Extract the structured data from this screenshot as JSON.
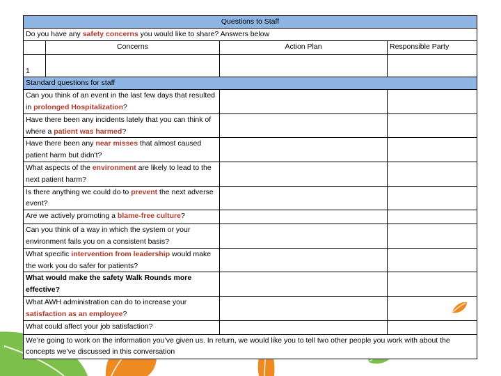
{
  "colors": {
    "header_blue": "#8DB4E2",
    "highlight_red": "#B0392C",
    "leaf_green": "#7CBF4B",
    "leaf_orange": "#ED8B22",
    "border": "#000000",
    "text": "#000000"
  },
  "table": {
    "title": "Questions to Staff",
    "prompt_prefix": "Do you have any ",
    "prompt_highlight": "safety concerns",
    "prompt_suffix": " you would like to share?  Answers below",
    "columns": {
      "number": "",
      "concerns": "Concerns",
      "action_plan": "Action Plan",
      "responsible_party": "Responsible Party"
    },
    "entry_row": {
      "number": "1",
      "concerns": "",
      "action_plan": "",
      "responsible_party": ""
    },
    "section_header": "Standard questions for staff",
    "questions": [
      {
        "id": "q-prolonged-hospitalization",
        "pre": "Can you think of an event in the last few days that resulted in ",
        "highlight": "prolonged Hospitalization",
        "highlight_style": "red",
        "post": "?",
        "lines": 2
      },
      {
        "id": "q-patient-was-harmed",
        "pre": "Have there been any incidents lately that you can think of where a ",
        "highlight": "patient was harmed",
        "highlight_style": "red",
        "post": "?",
        "lines": 2
      },
      {
        "id": "q-near-misses",
        "pre": "Have there been any ",
        "highlight": "near misses",
        "highlight_style": "red",
        "post": " that almost caused patient harm but didn't?",
        "lines": 2
      },
      {
        "id": "q-environment",
        "pre": "What aspects of the ",
        "highlight": "environment",
        "highlight_style": "red",
        "post": " are likely to lead to the next patient harm?",
        "lines": 2
      },
      {
        "id": "q-prevent",
        "pre": "Is there anything we could do to ",
        "highlight": "prevent",
        "highlight_style": "red",
        "post": " the next adverse event?",
        "lines": 2
      },
      {
        "id": "q-blame-free-culture",
        "pre": "Are we actively promoting a ",
        "highlight": "blame-free culture",
        "highlight_style": "red",
        "post": "?",
        "lines": 1
      },
      {
        "id": "q-system-fails",
        "pre": "Can you think of a way in which the system or your environment fails you on a consistent basis?",
        "highlight": "",
        "highlight_style": "none",
        "post": "",
        "lines": 2
      },
      {
        "id": "q-intervention-from-leadership",
        "pre": "What specific ",
        "highlight": "intervention from leadership",
        "highlight_style": "red",
        "post": " would make the work you do safer for patients?",
        "lines": 2
      },
      {
        "id": "q-walk-rounds-effective",
        "pre": "",
        "highlight": "What would make the safety Walk Rounds more effective?",
        "highlight_style": "black-bold",
        "post": "",
        "lines": 2
      },
      {
        "id": "q-satisfaction-as-employee",
        "pre": "What AWH administration can do to increase your ",
        "highlight": "satisfaction as an employee",
        "highlight_style": "red",
        "post": "?",
        "lines": 2
      },
      {
        "id": "q-job-satisfaction",
        "pre": "What could affect your job satisfaction?",
        "highlight": "",
        "highlight_style": "none",
        "post": "",
        "lines": 1
      }
    ],
    "closing_statement": "We’re going to work on the information you’ve given us.  In return, we would like you to tell two other people you work with about the concepts we’ve discussed in this conversation"
  },
  "decorations": [
    {
      "name": "leaf-green-large-bottom-left",
      "color": "#7CBF4B"
    },
    {
      "name": "leaf-orange-bottom-left",
      "color": "#ED8B22"
    },
    {
      "name": "leaf-orange-bottom-center",
      "color": "#ED8B22"
    },
    {
      "name": "leaf-green-small-bottom-right",
      "color": "#7CBF4B"
    },
    {
      "name": "leaf-orange-small-in-table",
      "color": "#ED8B22"
    }
  ]
}
